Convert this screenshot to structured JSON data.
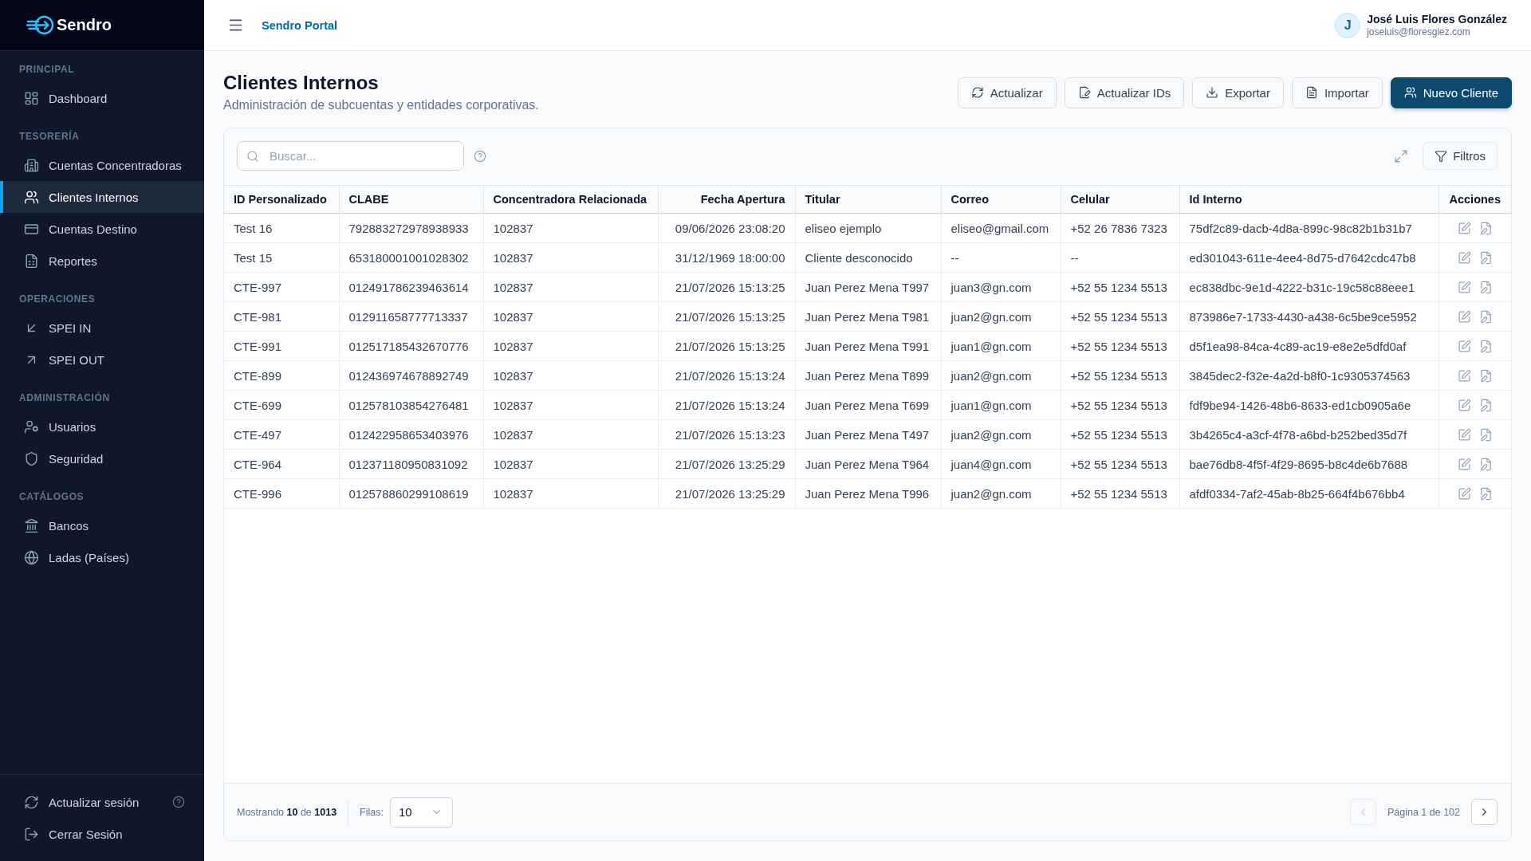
{
  "sidebar": {
    "brand": "Sendro",
    "sections": [
      {
        "title": "PRINCIPAL",
        "items": [
          {
            "label": "Dashboard",
            "selected": false
          }
        ]
      },
      {
        "title": "TESORERÍA",
        "items": [
          {
            "label": "Cuentas Concentradoras",
            "selected": false
          },
          {
            "label": "Clientes Internos",
            "selected": true
          },
          {
            "label": "Cuentas Destino",
            "selected": false
          },
          {
            "label": "Reportes",
            "selected": false
          }
        ]
      },
      {
        "title": "OPERACIONES",
        "items": [
          {
            "label": "SPEI IN",
            "selected": false
          },
          {
            "label": "SPEI OUT",
            "selected": false
          }
        ]
      },
      {
        "title": "ADMINISTRACIÓN",
        "items": [
          {
            "label": "Usuarios",
            "selected": false
          },
          {
            "label": "Seguridad",
            "selected": false
          }
        ]
      },
      {
        "title": "CATÁLOGOS",
        "items": [
          {
            "label": "Bancos",
            "selected": false
          },
          {
            "label": "Ladas (Países)",
            "selected": false
          }
        ]
      }
    ],
    "footer_items": [
      {
        "label": "Actualizar sesión"
      },
      {
        "label": "Cerrar Sesión"
      }
    ]
  },
  "topbar": {
    "title": "Sendro Portal",
    "user": {
      "initial": "J",
      "name": "José Luis Flores González",
      "email": "joseluis@floresglez.com"
    }
  },
  "page": {
    "title": "Clientes Internos",
    "subtitle": "Administración de subcuentas y entidades corporativas.",
    "actions": [
      {
        "label": "Actualizar",
        "kind": "secondary"
      },
      {
        "label": "Actualizar IDs",
        "kind": "secondary"
      },
      {
        "label": "Exportar",
        "kind": "secondary"
      },
      {
        "label": "Importar",
        "kind": "secondary"
      },
      {
        "label": "Nuevo Cliente",
        "kind": "primary"
      }
    ]
  },
  "toolbar": {
    "search": {
      "placeholder": "Buscar..."
    },
    "filter_button": "Filtros"
  },
  "table": {
    "columns": [
      {
        "label": "ID Personalizado",
        "kind": "text"
      },
      {
        "label": "CLABE",
        "kind": "text"
      },
      {
        "label": "Concentradora Relacionada",
        "kind": "text"
      },
      {
        "label": "Fecha Apertura",
        "kind": "date"
      },
      {
        "label": "Titular",
        "kind": "text"
      },
      {
        "label": "Correo",
        "kind": "text"
      },
      {
        "label": "Celular",
        "kind": "text"
      },
      {
        "label": "Id Interno",
        "kind": "text"
      },
      {
        "label": "Acciones",
        "kind": "actions"
      }
    ],
    "rows": [
      [
        "Test 16",
        "792883272978938933",
        "102837",
        "09/06/2026 23:08:20",
        "eliseo ejemplo",
        "eliseo@gmail.com",
        "+52 26 7836 7323",
        "75df2c89-dacb-4d8a-899c-98c82b1b31b7"
      ],
      [
        "Test 15",
        "653180001001028302",
        "102837",
        "31/12/1969 18:00:00",
        "Cliente desconocido",
        "--",
        "--",
        "ed301043-611e-4ee4-8d75-d7642cdc47b8"
      ],
      [
        "CTE-997",
        "012491786239463614",
        "102837",
        "21/07/2026 15:13:25",
        "Juan Perez Mena T997",
        "juan3@gn.com",
        "+52 55 1234 5513",
        "ec838dbc-9e1d-4222-b31c-19c58c88eee1"
      ],
      [
        "CTE-981",
        "012911658777713337",
        "102837",
        "21/07/2026 15:13:25",
        "Juan Perez Mena T981",
        "juan2@gn.com",
        "+52 55 1234 5513",
        "873986e7-1733-4430-a438-6c5be9ce5952"
      ],
      [
        "CTE-991",
        "012517185432670776",
        "102837",
        "21/07/2026 15:13:25",
        "Juan Perez Mena T991",
        "juan1@gn.com",
        "+52 55 1234 5513",
        "d5f1ea98-84ca-4c89-ac19-e8e2e5dfd0af"
      ],
      [
        "CTE-899",
        "012436974678892749",
        "102837",
        "21/07/2026 15:13:24",
        "Juan Perez Mena T899",
        "juan2@gn.com",
        "+52 55 1234 5513",
        "3845dec2-f32e-4a2d-b8f0-1c9305374563"
      ],
      [
        "CTE-699",
        "012578103854276481",
        "102837",
        "21/07/2026 15:13:24",
        "Juan Perez Mena T699",
        "juan1@gn.com",
        "+52 55 1234 5513",
        "fdf9be94-1426-48b6-8633-ed1cb0905a6e"
      ],
      [
        "CTE-497",
        "012422958653403976",
        "102837",
        "21/07/2026 15:13:23",
        "Juan Perez Mena T497",
        "juan2@gn.com",
        "+52 55 1234 5513",
        "3b4265c4-a3cf-4f78-a6bd-b252bed35d7f"
      ],
      [
        "CTE-964",
        "012371180950831092",
        "102837",
        "21/07/2026 13:25:29",
        "Juan Perez Mena T964",
        "juan4@gn.com",
        "+52 55 1234 5513",
        "bae76db8-4f5f-4f29-8695-b8c4de6b7688"
      ],
      [
        "CTE-996",
        "012578860299108619",
        "102837",
        "21/07/2026 13:25:29",
        "Juan Perez Mena T996",
        "juan2@gn.com",
        "+52 55 1234 5513",
        "afdf0334-7af2-45ab-8b25-664f4b676bb4"
      ]
    ]
  },
  "footer": {
    "summary": "Mostrando **10** de **1013**",
    "rows_label": "Filas:",
    "rows_per_page": "10",
    "pagination": {
      "label": "Página 1 de 102",
      "previous_disabled": true,
      "next_disabled": false
    }
  }
}
